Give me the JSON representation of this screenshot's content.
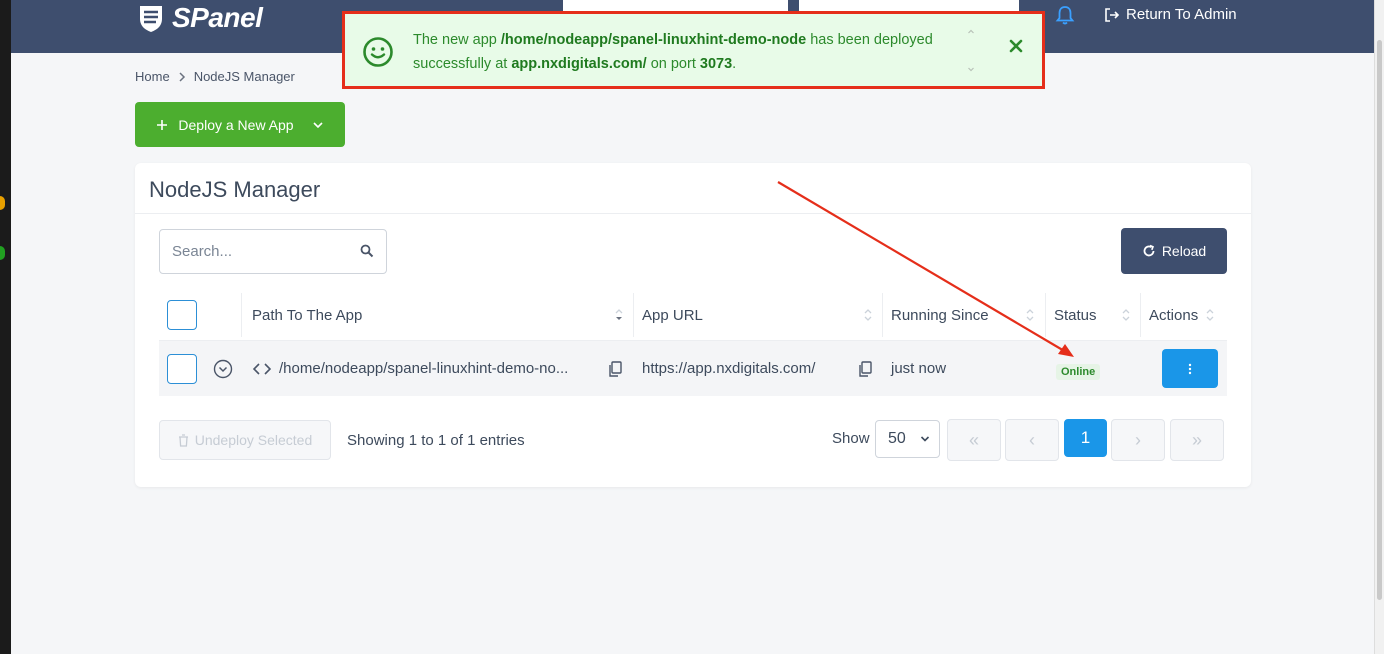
{
  "brand": {
    "logo_text": "SPanel",
    "accent": "#4cae2f",
    "topbar_color": "#3e4e6e"
  },
  "header": {
    "return_admin_label": "Return To Admin"
  },
  "breadcrumb": {
    "home": "Home",
    "current": "NodeJS Manager"
  },
  "toolbar": {
    "deploy_label": "Deploy a New App"
  },
  "toast": {
    "prefix": "The new app ",
    "path": "/home/nodeapp/spanel-linuxhint-demo-node",
    "middle1": " has been deployed successfully at ",
    "url": "app.nxdigitals.com/",
    "middle2": " on port ",
    "port": "3073",
    "suffix": "."
  },
  "card": {
    "title": "NodeJS Manager",
    "search_placeholder": "Search...",
    "reload_label": "Reload"
  },
  "table": {
    "columns": [
      "Path To The App",
      "App URL",
      "Running Since",
      "Status",
      "Actions"
    ],
    "rows": [
      {
        "path": "/home/nodeapp/spanel-linuxhint-demo-no...",
        "url": "https://app.nxdigitals.com/",
        "running_since": "just now",
        "status": "Online"
      }
    ]
  },
  "footer": {
    "undeploy_label": "Undeploy Selected",
    "entries_info": "Showing 1 to 1 of 1 entries",
    "show_label": "Show",
    "page_size": "50",
    "pagination": {
      "first": "«",
      "prev": "‹",
      "current_page": "1",
      "next": "›",
      "last": "»"
    }
  }
}
